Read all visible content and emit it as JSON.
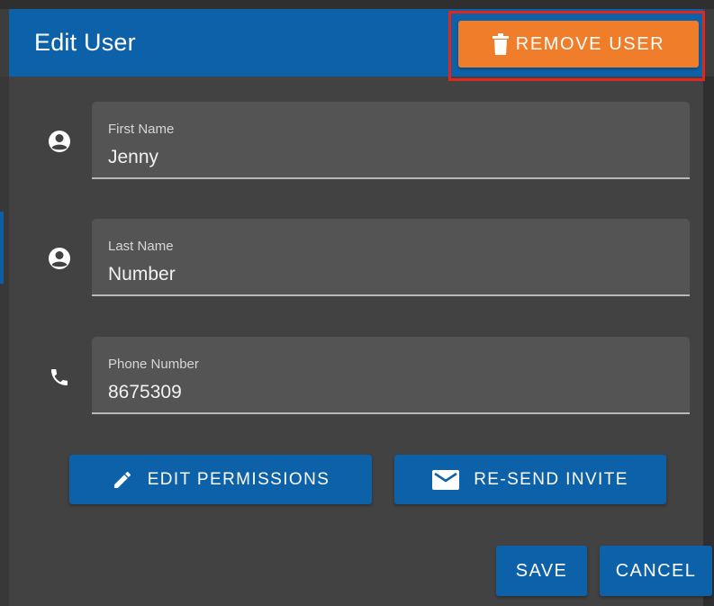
{
  "dialog": {
    "title": "Edit User",
    "remove_button": {
      "label": "REMOVE USER",
      "icon": "trash-icon",
      "color": "#f07d2a",
      "highlight_color": "#e1261c"
    },
    "header_color": "#0d61a8"
  },
  "fields": {
    "first_name": {
      "label": "First Name",
      "value": "Jenny",
      "icon": "account-circle-icon"
    },
    "last_name": {
      "label": "Last Name",
      "value": "Number",
      "icon": "account-circle-icon"
    },
    "phone": {
      "label": "Phone Number",
      "value": "8675309",
      "icon": "phone-icon"
    }
  },
  "actions": {
    "edit_permissions": {
      "label": "EDIT PERMISSIONS",
      "icon": "pencil-icon"
    },
    "resend_invite": {
      "label": "RE-SEND INVITE",
      "icon": "mail-icon"
    },
    "save": {
      "label": "SAVE"
    },
    "cancel": {
      "label": "CANCEL"
    }
  }
}
